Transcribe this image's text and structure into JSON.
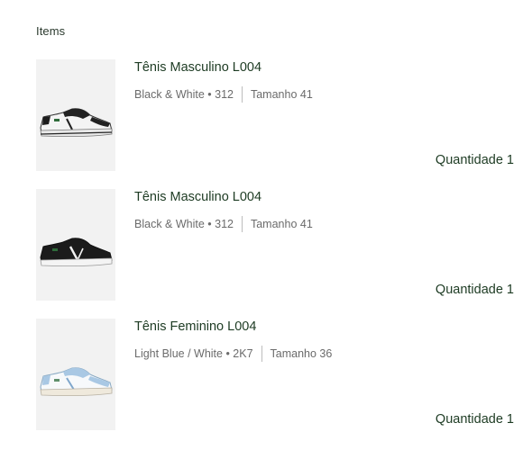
{
  "section": {
    "title": "Items"
  },
  "items": [
    {
      "title": "Tênis Masculino L004",
      "variant": "Black & White • 312",
      "size": "Tamanho 41",
      "quantity": "Quantidade 1",
      "image_icon": "white-black-sneaker-image"
    },
    {
      "title": "Tênis Masculino L004",
      "variant": "Black & White • 312",
      "size": "Tamanho 41",
      "quantity": "Quantidade 1",
      "image_icon": "black-sneaker-image"
    },
    {
      "title": "Tênis Feminino L004",
      "variant": "Light Blue / White • 2K7",
      "size": "Tamanho 36",
      "quantity": "Quantidade 1",
      "image_icon": "light-blue-sneaker-image"
    }
  ],
  "colors": {
    "brand_green": "#1d3b23",
    "meta_gray": "#6b6b6b",
    "thumb_bg": "#f2f2f2"
  }
}
